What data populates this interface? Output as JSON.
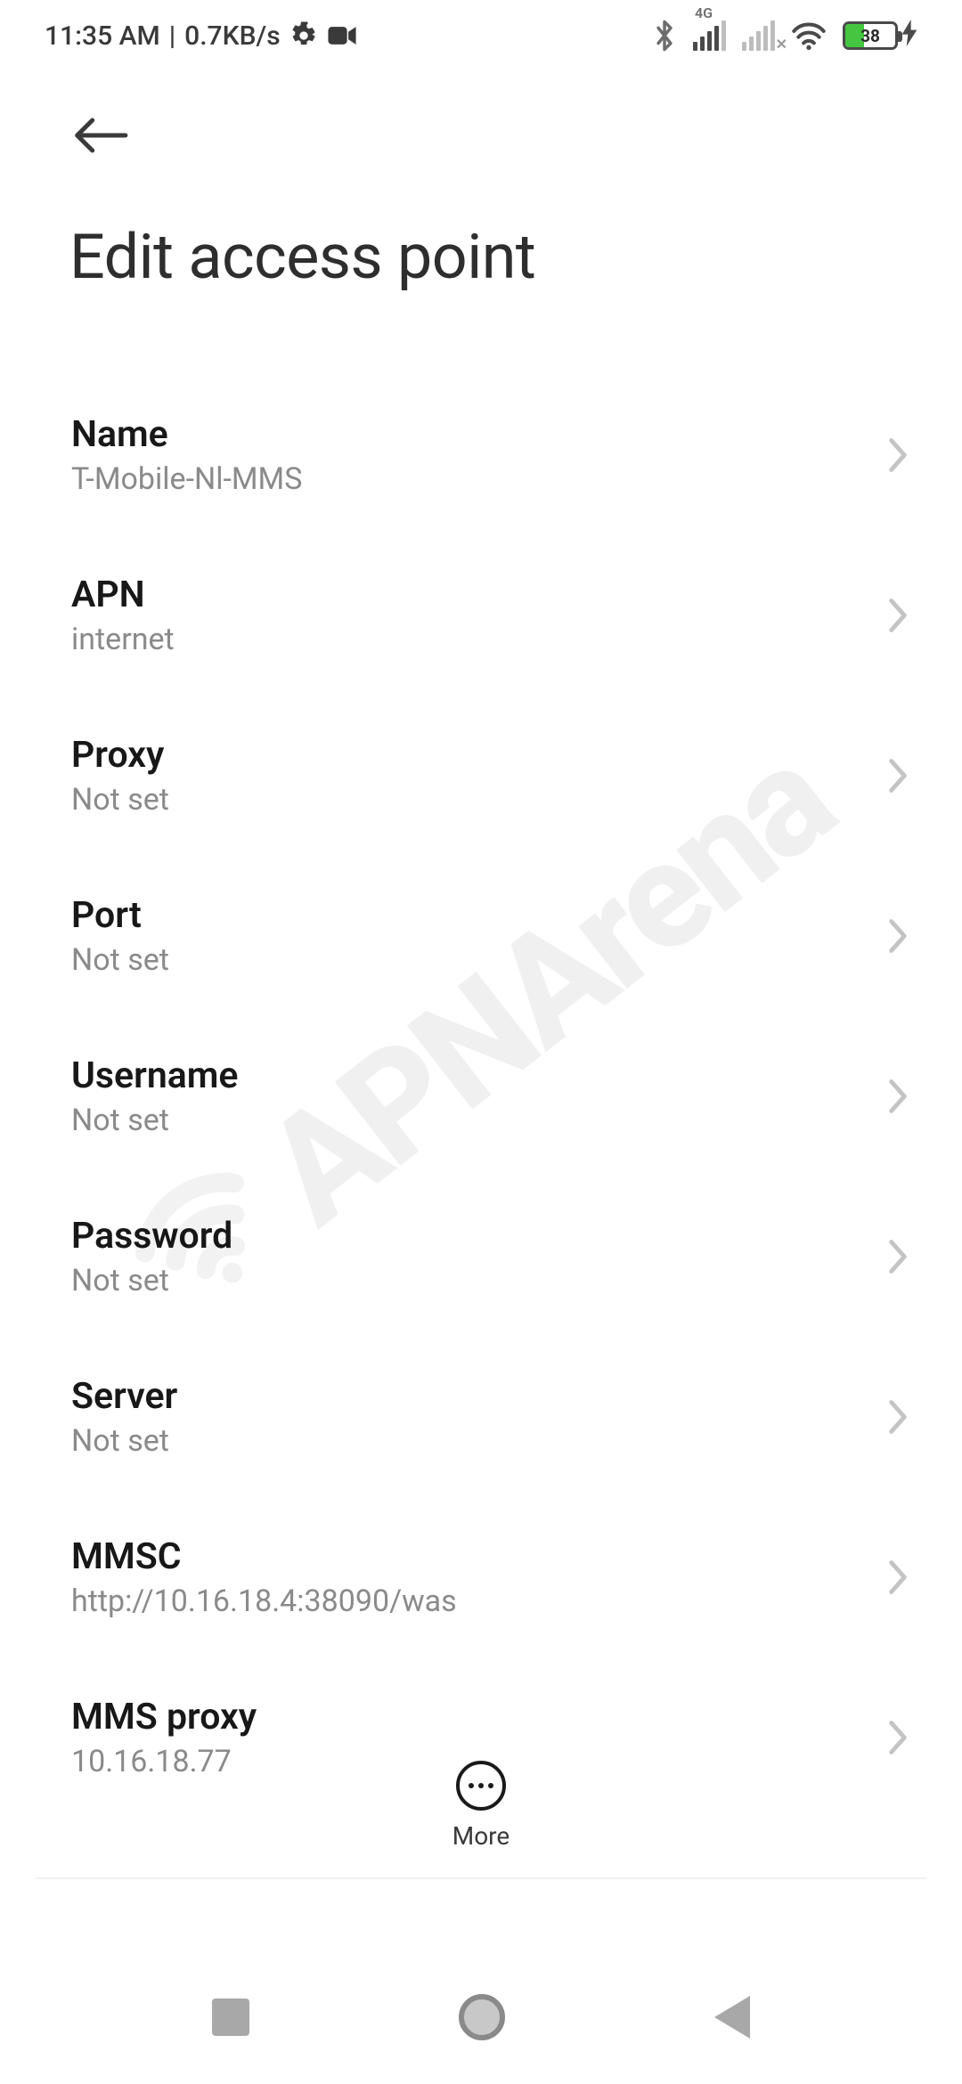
{
  "status_bar": {
    "time": "11:35 AM",
    "separator": "|",
    "speed": "0.7KB/s",
    "signal_4g_label": "4G",
    "battery_text": "38"
  },
  "header": {
    "title": "Edit access point"
  },
  "list": [
    {
      "label": "Name",
      "value": "T-Mobile-Nl-MMS"
    },
    {
      "label": "APN",
      "value": "internet"
    },
    {
      "label": "Proxy",
      "value": "Not set"
    },
    {
      "label": "Port",
      "value": "Not set"
    },
    {
      "label": "Username",
      "value": "Not set"
    },
    {
      "label": "Password",
      "value": "Not set"
    },
    {
      "label": "Server",
      "value": "Not set"
    },
    {
      "label": "MMSC",
      "value": "http://10.16.18.4:38090/was"
    },
    {
      "label": "MMS proxy",
      "value": "10.16.18.77"
    }
  ],
  "bottom_action": {
    "more_label": "More"
  },
  "watermark_text": "APNArena"
}
